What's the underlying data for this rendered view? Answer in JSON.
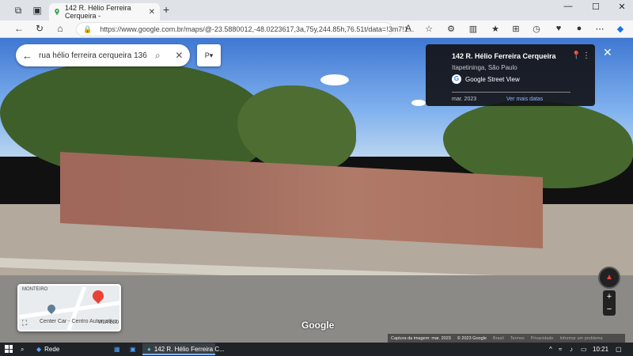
{
  "browser": {
    "tab_title": "142 R. Hélio Ferreira Cerqueira -",
    "url": "https://www.google.com.br/maps/@-23.5880012,-48.0223617,3a,75y,244.85h,76.51t/data=!3m7!1..."
  },
  "maps": {
    "search_query": "rua hélio ferreira cerqueira 136",
    "peg_label": "P",
    "info_title": "142 R. Hélio Ferreira Cerqueira",
    "info_subtitle": "Itapetininga, São Paulo",
    "street_view_label": "Google Street View",
    "capture_date": "mar. 2023",
    "more_dates": "Ver mais datas",
    "minimap_label_top": "MONTEIRO",
    "minimap_poi": "Center Car - Centro Automotivo",
    "minimap_label_right": "VILA ELO",
    "logo": "Google",
    "footer": {
      "capture": "Captura da imagem: mar. 2023",
      "copyright": "© 2023 Google",
      "country": "Brasil",
      "terms": "Termos",
      "privacy": "Privacidade",
      "report": "Informar um problema"
    }
  },
  "taskbar": {
    "weather": "Rede",
    "active_window": "142 R. Hélio Ferreira C...",
    "time": "10:21"
  }
}
